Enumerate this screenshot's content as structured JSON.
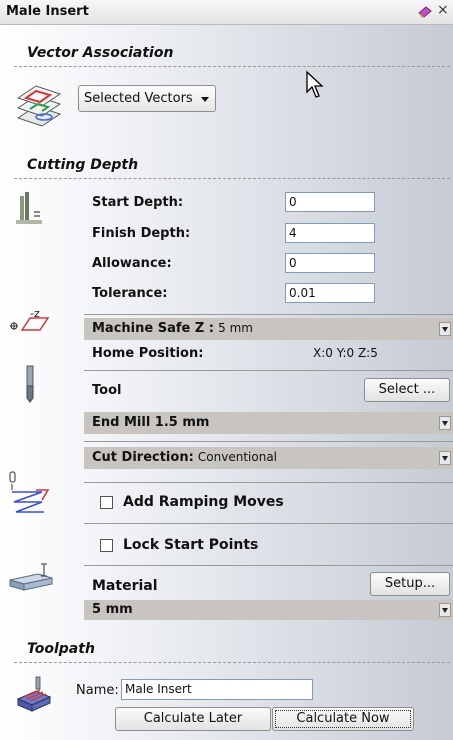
{
  "window": {
    "title": "Male Insert",
    "pin_icon": "pin-icon",
    "close_glyph": "×"
  },
  "vector_association": {
    "heading": "Vector Association",
    "dropdown_value": "Selected Vectors"
  },
  "cutting_depth": {
    "heading": "Cutting Depth",
    "start_depth_label": "Start Depth:",
    "start_depth_value": "0",
    "finish_depth_label": "Finish Depth:",
    "finish_depth_value": "4",
    "allowance_label": "Allowance:",
    "allowance_value": "0",
    "tolerance_label": "Tolerance:",
    "tolerance_value": "0.01"
  },
  "machine": {
    "safe_z_label": "Machine Safe Z :",
    "safe_z_value": "5 mm",
    "home_label": "Home Position:",
    "home_value": "X:0 Y:0 Z:5",
    "z_icon_text": "-z"
  },
  "tool": {
    "label": "Tool",
    "select_button": "Select ...",
    "tool_name": "End Mill 1.5 mm",
    "cut_direction_label": "Cut Direction:",
    "cut_direction_value": "Conventional"
  },
  "ramping": {
    "label": "Add Ramping Moves",
    "checked": false
  },
  "lock_start": {
    "label": "Lock Start Points",
    "checked": false
  },
  "material": {
    "label": "Material",
    "setup_button": "Setup...",
    "thickness": "5 mm"
  },
  "toolpath": {
    "heading": "Toolpath",
    "name_label": "Name:",
    "name_value": "Male Insert",
    "calculate_later": "Calculate Later",
    "calculate_now": "Calculate Now"
  },
  "colors": {
    "accent_red": "#d23a3a",
    "accent_green": "#2e9a4a",
    "input_border": "#7f9db9"
  }
}
